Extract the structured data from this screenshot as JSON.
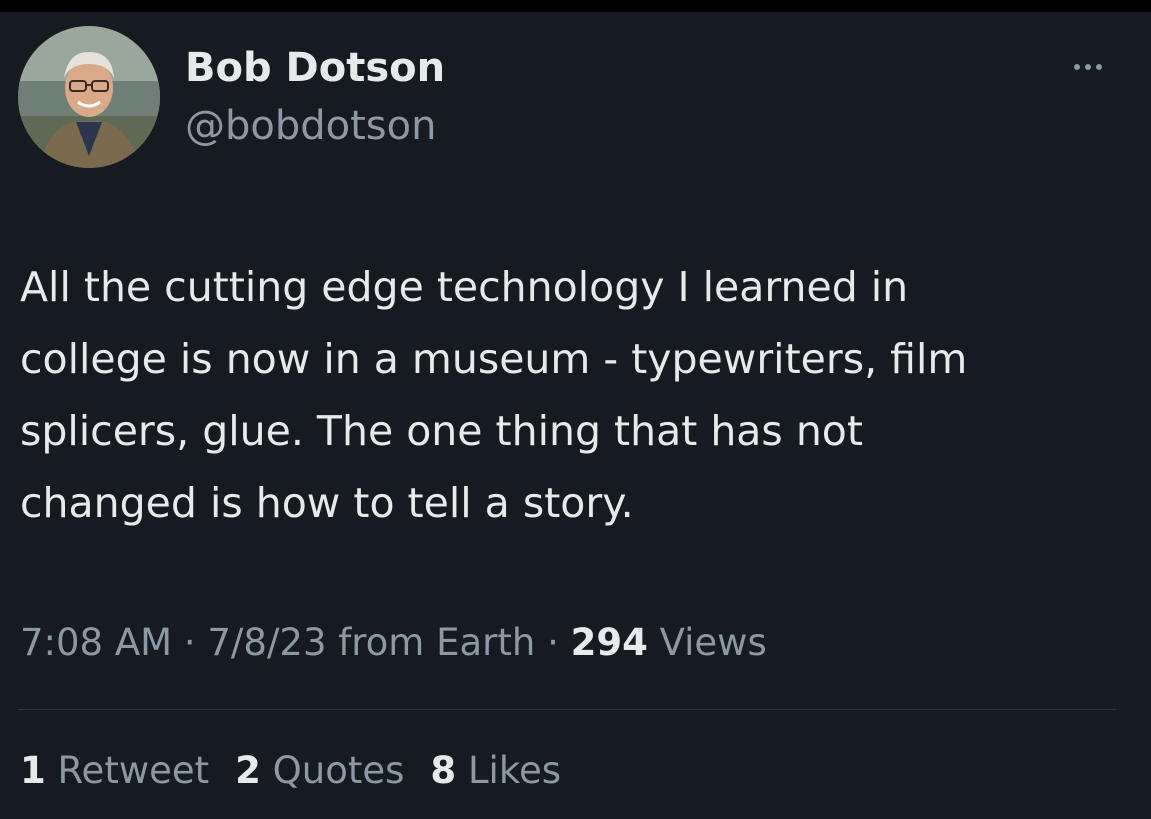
{
  "author": {
    "display_name": "Bob Dotson",
    "handle": "@bobdotson"
  },
  "more_icon": "more-horizontal-icon",
  "tweet": {
    "lines": [
      "All the cutting edge technology I learned in",
      "college is now in a museum - typewriters, film",
      "splicers, glue. The one thing that has not",
      "changed is how to tell a story."
    ]
  },
  "meta": {
    "time": "7:08 AM",
    "separator": "·",
    "date_source": "7/8/23 from Earth",
    "views_count": "294",
    "views_label": "Views"
  },
  "stats": {
    "retweets_count": "1",
    "retweets_label": "Retweet",
    "quotes_count": "2",
    "quotes_label": "Quotes",
    "likes_count": "8",
    "likes_label": "Likes"
  },
  "colors": {
    "background": "#161b22",
    "primary_text": "#e7e9ea",
    "secondary_text": "#8b98a5",
    "divider": "#2f3640"
  }
}
